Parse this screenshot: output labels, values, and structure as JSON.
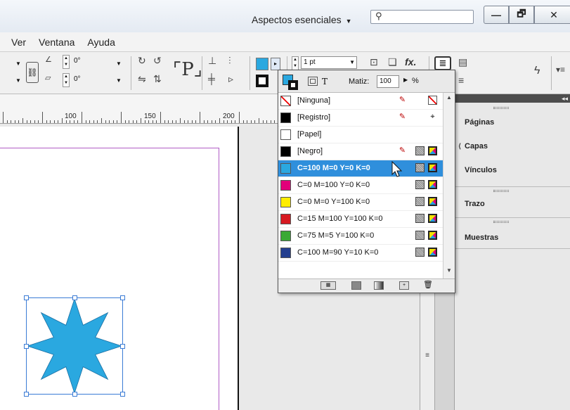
{
  "titlebar": {
    "workspace": "Aspectos esenciales",
    "window_buttons": [
      "—",
      "🗗",
      "✕"
    ]
  },
  "menubar": {
    "items": [
      "Ver",
      "Ventana",
      "Ayuda"
    ]
  },
  "toolbar": {
    "angle_1": "0°",
    "angle_2": "0°",
    "stroke_weight": "1 pt",
    "tint_label": "Matiz:",
    "tint_value": "100",
    "tint_unit": "%"
  },
  "ruler": {
    "labels": [
      "100",
      "150",
      "200"
    ]
  },
  "swatches_panel": {
    "fill_stroke_text_icon": "T",
    "rows": [
      {
        "name": "[Ninguna]",
        "color": "none",
        "icons": [
          "no-edit",
          "none-mode"
        ]
      },
      {
        "name": "[Registro]",
        "color": "#000000",
        "icons": [
          "no-edit",
          "registration"
        ]
      },
      {
        "name": "[Papel]",
        "color": "#ffffff",
        "icons": []
      },
      {
        "name": "[Negro]",
        "color": "#000000",
        "icons": [
          "no-edit",
          "process",
          "cmyk"
        ]
      },
      {
        "name": "C=100 M=0 Y=0 K=0",
        "color": "#2aa8e0",
        "icons": [
          "process",
          "cmyk"
        ],
        "selected": true
      },
      {
        "name": "C=0 M=100 Y=0 K=0",
        "color": "#e2007a",
        "icons": [
          "process",
          "cmyk"
        ]
      },
      {
        "name": "C=0 M=0 Y=100 K=0",
        "color": "#ffed00",
        "icons": [
          "process",
          "cmyk"
        ]
      },
      {
        "name": "C=15 M=100 Y=100 K=0",
        "color": "#d71a21",
        "icons": [
          "process",
          "cmyk"
        ]
      },
      {
        "name": "C=75 M=5 Y=100 K=0",
        "color": "#3aa935",
        "icons": [
          "process",
          "cmyk"
        ]
      },
      {
        "name": "C=100 M=90 Y=10 K=0",
        "color": "#243f8f",
        "icons": [
          "process",
          "cmyk"
        ]
      }
    ]
  },
  "panels": {
    "collapse_glyph": "◂◂",
    "items": [
      "Páginas",
      "Capas",
      "Vínculos",
      "Trazo",
      "Muestras"
    ]
  },
  "colors": {
    "accent_cyan": "#2aa8e0",
    "selection_blue": "#2f8fdc",
    "margin_guide": "#b05cc6"
  }
}
